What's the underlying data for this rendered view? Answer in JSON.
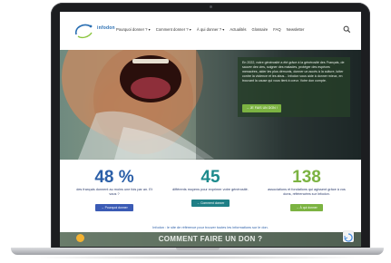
{
  "header": {
    "logo_text": "infodon",
    "nav": [
      "Pourquoi donner ? ▾",
      "Comment donner ? ▾",
      "À qui donner ? ▾",
      "Actualités",
      "Glossaire",
      "FAQ",
      "Newsletter"
    ]
  },
  "hero": {
    "text": "En 2022, notre générosité a été grâce à la générosité des Français, de sauver des vies, soigner des malades, protéger des espèces menacées, aider les plus démunis, donner un accès à la culture, lutter contre la violence et les abus... Infodon vous aide à donner mieux, en trouvant la cause qui vous tient à cœur. Votre don compte.",
    "button": "→ JE FAIS UN DON !"
  },
  "stats": [
    {
      "number": "48 %",
      "desc": "des français donnent au moins une fois par an. Et vous ?",
      "button": "→ Pourquoi donner",
      "color": "#2b5fa8",
      "button_color": "#3b5bb5"
    },
    {
      "number": "45",
      "desc": "différents moyens pour exprimer votre générosité.",
      "button": "→ Comment donner",
      "color": "#1c8a8c",
      "button_color": "#1f7f86"
    },
    {
      "number": "138",
      "desc": "associations et fondations qui agissent grâce à vos dons, référencées sur Infodon.",
      "button": "→ À qui donner",
      "color": "#7cb342",
      "button_color": "#7cb342"
    }
  ],
  "tagline": "Infodon : le site de référence pour trouver toutes les informations sur le don.",
  "bottom": {
    "title": "COMMENT FAIRE UN DON ?"
  },
  "icons": {
    "search": "search-icon",
    "chat": "chat-icon",
    "recaptcha": "recaptcha-icon"
  }
}
